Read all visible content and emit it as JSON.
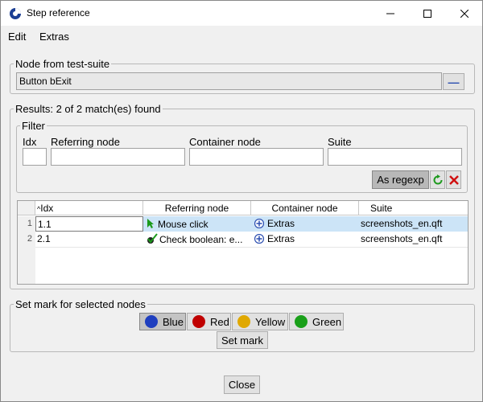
{
  "window": {
    "title": "Step reference"
  },
  "menu": {
    "edit": "Edit",
    "extras": "Extras"
  },
  "node_group": {
    "legend": "Node from test-suite",
    "value": "Button bExit",
    "remove_symbol": "—"
  },
  "results": {
    "legend": "Results: 2 of 2 match(es) found"
  },
  "filter": {
    "legend": "Filter",
    "idx_label": "Idx",
    "referring_label": "Referring node",
    "container_label": "Container node",
    "suite_label": "Suite",
    "idx_value": "",
    "referring_value": "",
    "container_value": "",
    "suite_value": "",
    "regexp_button": "As regexp"
  },
  "table": {
    "columns": [
      "Idx",
      "Referring node",
      "Container node",
      "Suite"
    ],
    "rows": [
      {
        "num": "1",
        "idx": "1.1",
        "referring": "Mouse click",
        "container": "Extras",
        "suite": "screenshots_en.qft",
        "selected": true
      },
      {
        "num": "2",
        "idx": "2.1",
        "referring": "Check boolean: e...",
        "container": "Extras",
        "suite": "screenshots_en.qft",
        "selected": false
      }
    ]
  },
  "marks": {
    "legend": "Set mark for selected nodes",
    "blue": "Blue",
    "red": "Red",
    "yellow": "Yellow",
    "green": "Green",
    "set_mark": "Set mark",
    "colors": {
      "blue": "#1f3fbf",
      "red": "#c00000",
      "yellow": "#e0a800",
      "green": "#1aa01a"
    }
  },
  "footer": {
    "close": "Close"
  },
  "colors": {
    "selection": "#cce4f7",
    "accent": "#2a4db0"
  }
}
